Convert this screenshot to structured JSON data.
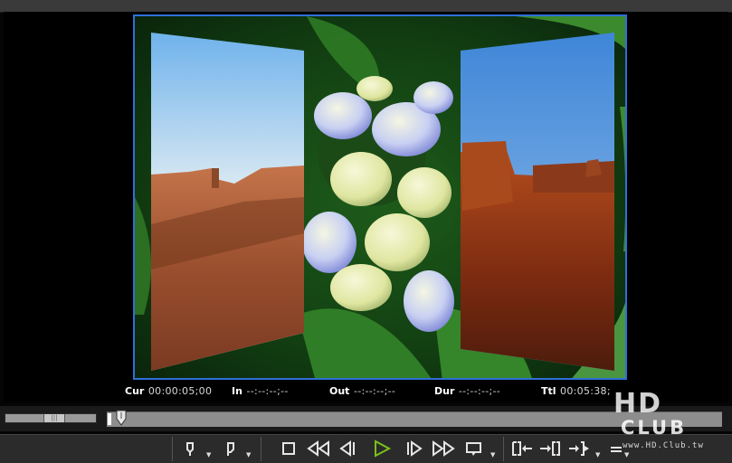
{
  "timecodes": {
    "cur": {
      "label": "Cur",
      "value": "00:00:05;00"
    },
    "in": {
      "label": "In",
      "value": "--:--:--;--"
    },
    "out": {
      "label": "Out",
      "value": "--:--:--;--"
    },
    "dur": {
      "label": "Dur",
      "value": "--:--:--;--"
    },
    "ttl": {
      "label": "Ttl",
      "value": "00:05:38;"
    }
  },
  "controls": {
    "set_in_icon": "mark-in-icon",
    "set_out_icon": "mark-out-icon",
    "stop_icon": "stop-icon",
    "rewind_icon": "rewind-icon",
    "prev_frame_icon": "previous-frame-icon",
    "play_icon": "play-icon",
    "next_frame_icon": "next-frame-icon",
    "fast_forward_icon": "fast-forward-icon",
    "loop_icon": "loop-playback-icon",
    "go_in_icon": "go-to-in-icon",
    "go_out_icon": "go-to-out-icon",
    "insert_icon": "insert-icon"
  },
  "colors": {
    "frame_border": "#2f6fd8",
    "play_green": "#7ac21c",
    "track": "#8d8d8d"
  },
  "watermark": {
    "line1": "HD",
    "line2": "CLUB",
    "url": "www.HD.Club.tw"
  }
}
